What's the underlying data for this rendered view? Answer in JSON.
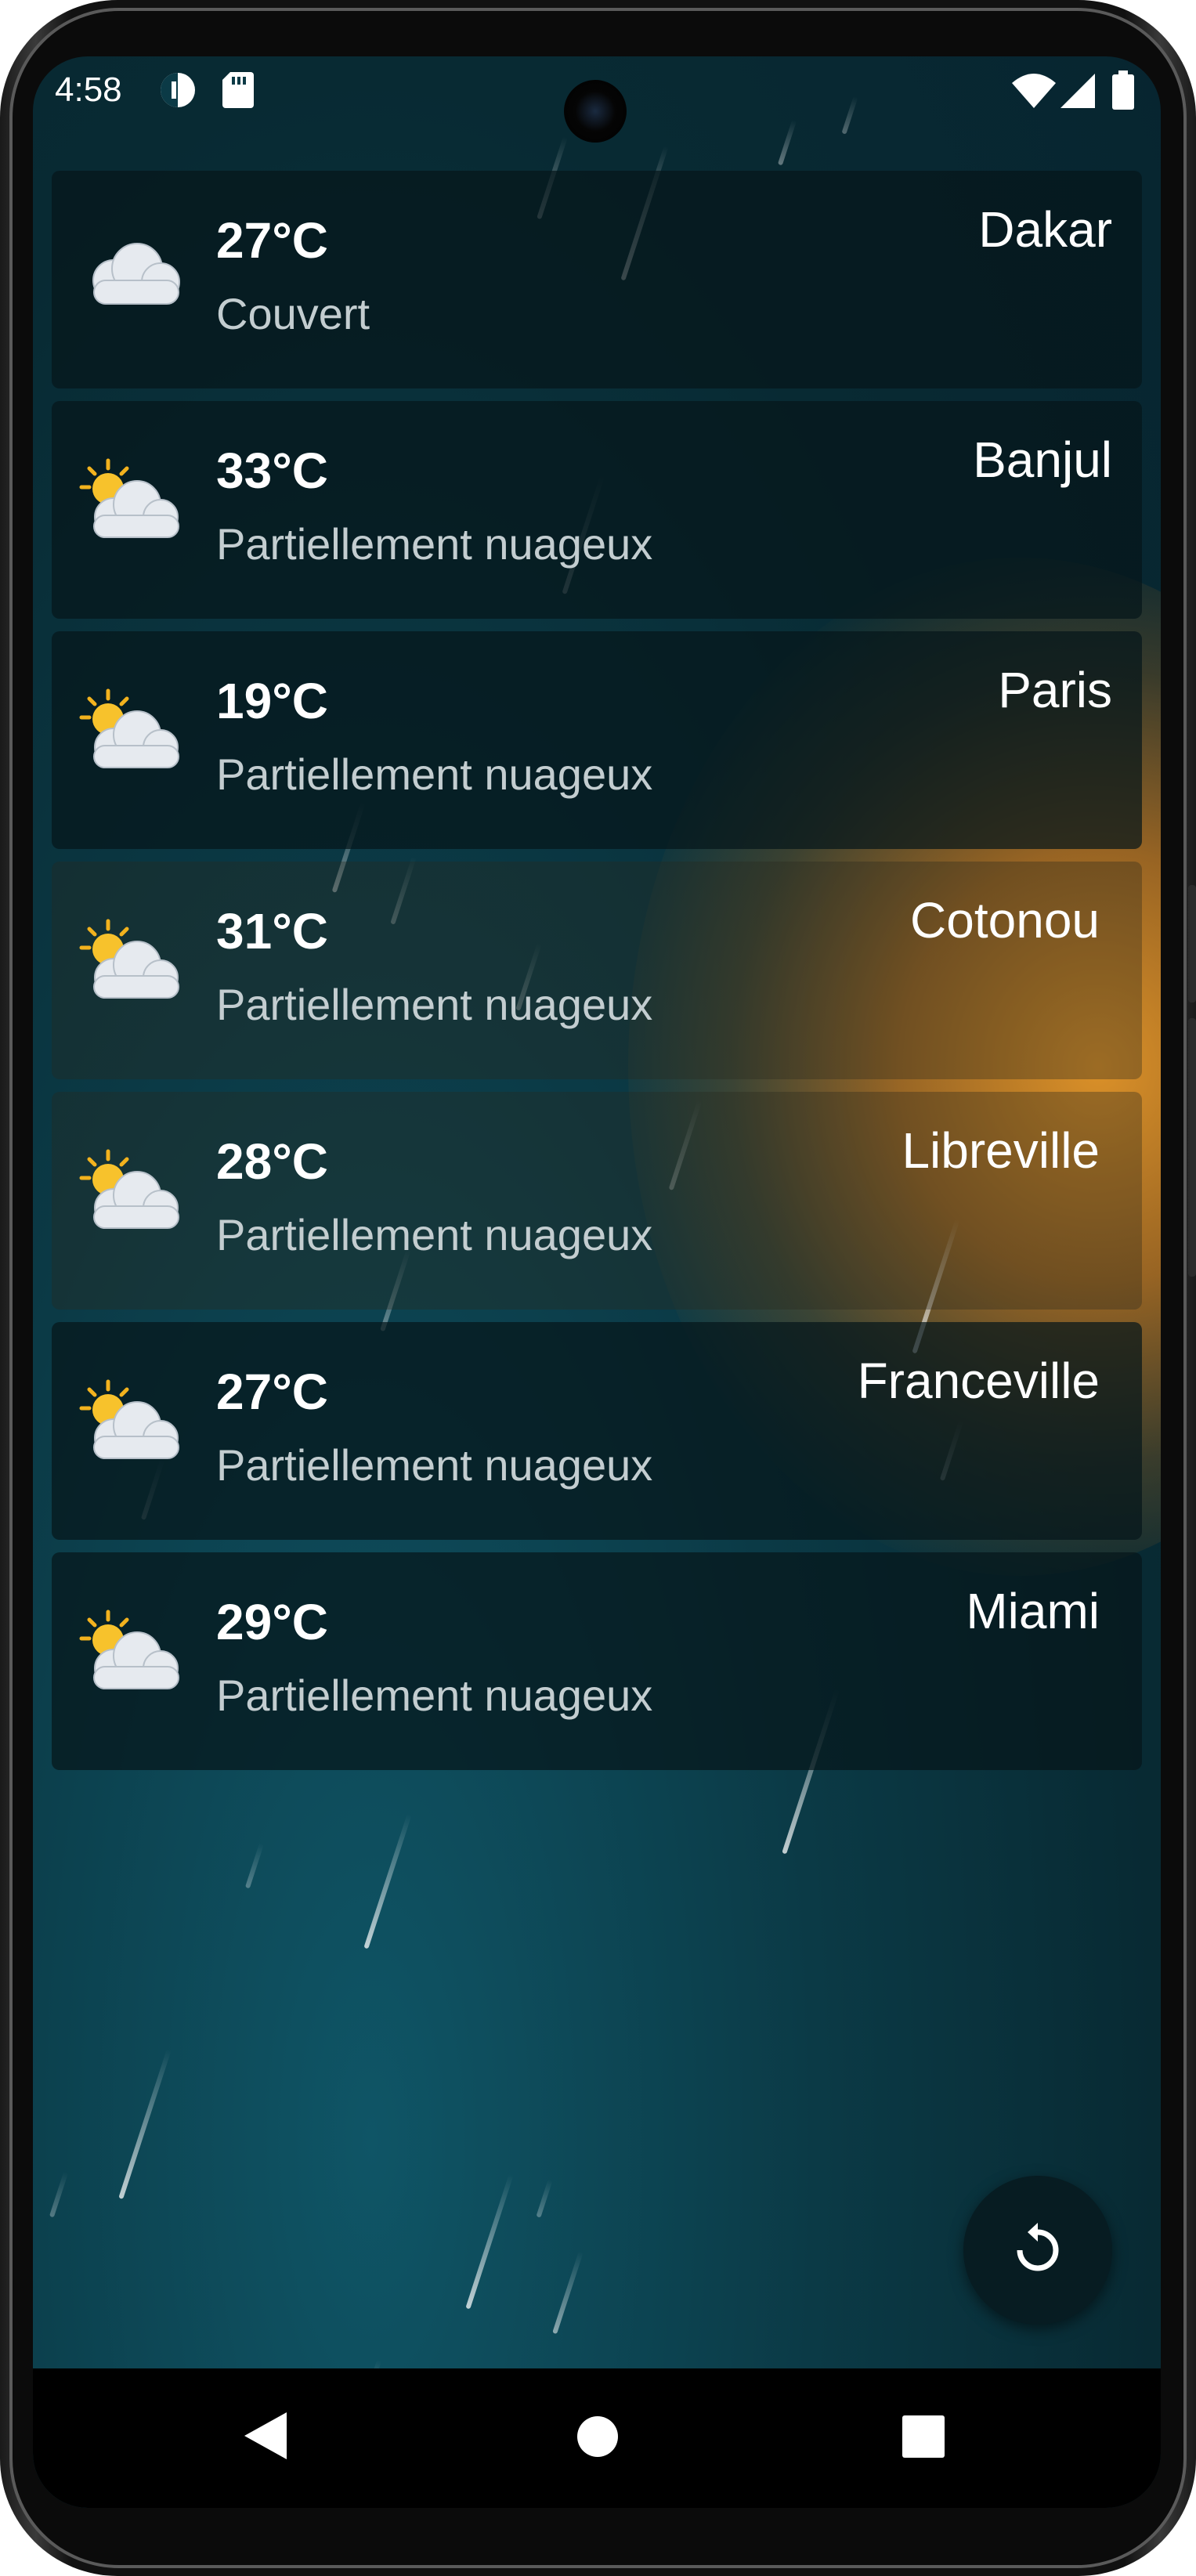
{
  "status_bar": {
    "time": "4:58",
    "left_icons": [
      "data-saver-icon",
      "sd-card-icon"
    ],
    "right_icons": [
      "wifi-icon",
      "signal-icon",
      "battery-icon"
    ]
  },
  "weather_cards": [
    {
      "temp": "27°C",
      "condition": "Couvert",
      "city": "Dakar",
      "icon": "cloud-icon"
    },
    {
      "temp": "33°C",
      "condition": "Partiellement nuageux",
      "city": "Banjul",
      "icon": "partly-cloudy-icon"
    },
    {
      "temp": "19°C",
      "condition": "Partiellement nuageux",
      "city": "Paris",
      "icon": "partly-cloudy-icon"
    },
    {
      "temp": "31°C",
      "condition": "Partiellement nuageux",
      "city": "Cotonou",
      "icon": "partly-cloudy-icon"
    },
    {
      "temp": "28°C",
      "condition": "Partiellement nuageux",
      "city": "Libreville",
      "icon": "partly-cloudy-icon"
    },
    {
      "temp": "27°C",
      "condition": "Partiellement nuageux",
      "city": "Franceville",
      "icon": "partly-cloudy-icon"
    },
    {
      "temp": "29°C",
      "condition": "Partiellement nuageux",
      "city": "Miami",
      "icon": "partly-cloudy-icon"
    }
  ],
  "fab": {
    "icon": "refresh-icon"
  },
  "nav_bar": {
    "icons": [
      "back-icon",
      "home-icon",
      "recents-icon"
    ]
  },
  "colors": {
    "background": "#0b3a46",
    "card": "#05161a",
    "sun_glow": "#e6962a",
    "text_primary": "#ffffff",
    "text_secondary": "#c3cdd0"
  }
}
